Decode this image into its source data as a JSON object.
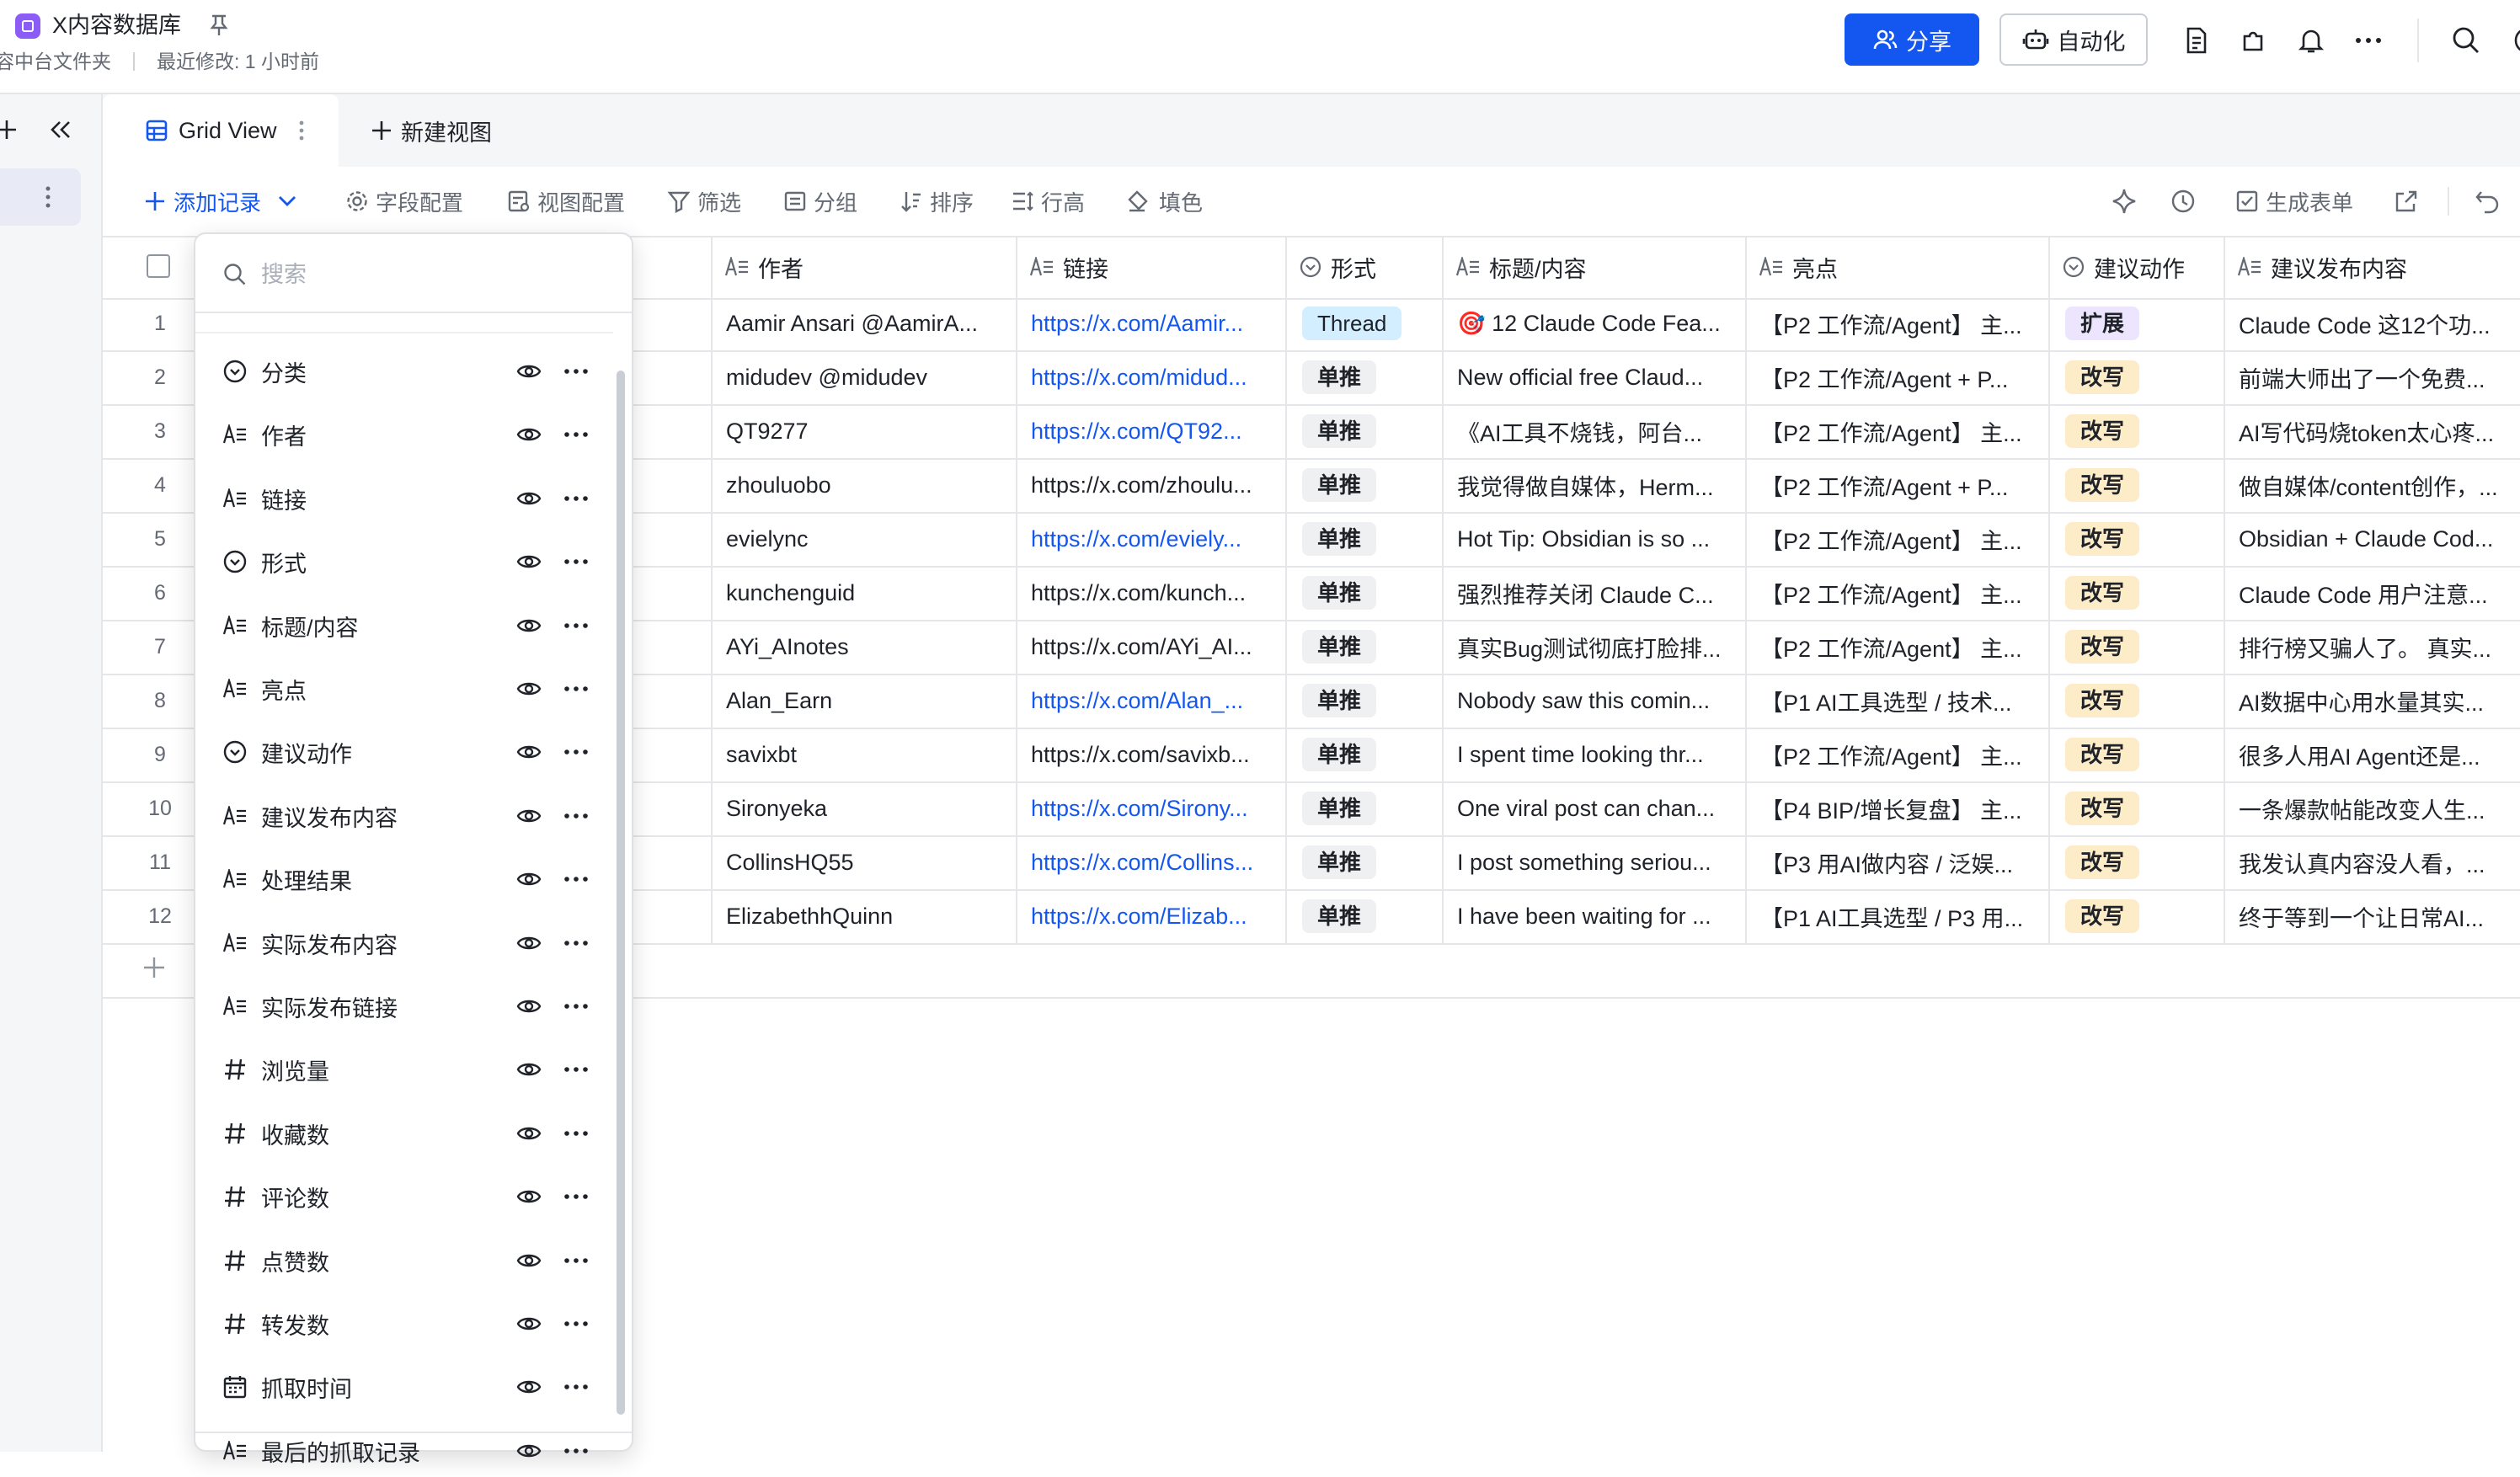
{
  "header": {
    "app_title": "X内容数据库",
    "breadcrumb_folder": "容中台文件夹",
    "last_modified": "最近修改: 1 小时前",
    "share_label": "分享",
    "automation_label": "自动化"
  },
  "tabs": {
    "grid_view": "Grid View",
    "new_view": "新建视图"
  },
  "toolbar": {
    "add_record": "添加记录",
    "field_config": "字段配置",
    "view_config": "视图配置",
    "filter": "筛选",
    "group": "分组",
    "sort": "排序",
    "row_height": "行高",
    "fill_color": "填色",
    "generate_form": "生成表单"
  },
  "columns": {
    "author": "作者",
    "link": "链接",
    "format": "形式",
    "title": "标题/内容",
    "highlight": "亮点",
    "action": "建议动作",
    "suggested_content": "建议发布内容"
  },
  "rows": [
    {
      "num": "1",
      "author": "Aamir Ansari @AamirA...",
      "link": "https://x.com/Aamir...",
      "link_blue": true,
      "format": "Thread",
      "title": "🎯 12 Claude Code Fea...",
      "highlight": "【P2 工作流/Agent】 主...",
      "action": "扩展",
      "content": "Claude Code 这12个功..."
    },
    {
      "num": "2",
      "author": "midudev @midudev",
      "link": "https://x.com/midud...",
      "link_blue": true,
      "format": "单推",
      "title": "New official free Claud...",
      "highlight": "【P2 工作流/Agent + P...",
      "action": "改写",
      "content": "前端大师出了一个免费..."
    },
    {
      "num": "3",
      "author": "QT9277",
      "link": "https://x.com/QT92...",
      "link_blue": true,
      "format": "单推",
      "title": "《AI工具不烧钱，阿台...",
      "highlight": "【P2 工作流/Agent】 主...",
      "action": "改写",
      "content": "AI写代码烧token太心疼..."
    },
    {
      "num": "4",
      "author": "zhouluobo",
      "link": "https://x.com/zhoulu...",
      "link_blue": false,
      "format": "单推",
      "title": "我觉得做自媒体，Herm...",
      "highlight": "【P2 工作流/Agent + P...",
      "action": "改写",
      "content": "做自媒体/content创作，..."
    },
    {
      "num": "5",
      "author": "evielync",
      "link": "https://x.com/eviely...",
      "link_blue": true,
      "format": "单推",
      "title": "Hot Tip: Obsidian is so ...",
      "highlight": "【P2 工作流/Agent】 主...",
      "action": "改写",
      "content": "Obsidian + Claude Cod..."
    },
    {
      "num": "6",
      "author": "kunchenguid",
      "link": "https://x.com/kunch...",
      "link_blue": false,
      "format": "单推",
      "title": "强烈推荐关闭 Claude C...",
      "highlight": "【P2 工作流/Agent】 主...",
      "action": "改写",
      "content": "Claude Code 用户注意..."
    },
    {
      "num": "7",
      "author": "AYi_AInotes",
      "link": "https://x.com/AYi_AI...",
      "link_blue": false,
      "format": "单推",
      "title": "真实Bug测试彻底打脸排...",
      "highlight": "【P2 工作流/Agent】 主...",
      "action": "改写",
      "content": "排行榜又骗人了。 真实..."
    },
    {
      "num": "8",
      "author": "Alan_Earn",
      "link": "https://x.com/Alan_...",
      "link_blue": true,
      "format": "单推",
      "title": "Nobody saw this comin...",
      "highlight": "【P1 AI工具选型 / 技术...",
      "action": "改写",
      "content": "AI数据中心用水量其实..."
    },
    {
      "num": "9",
      "author": "savixbt",
      "link": "https://x.com/savixb...",
      "link_blue": false,
      "format": "单推",
      "title": "I spent time looking thr...",
      "highlight": "【P2 工作流/Agent】 主...",
      "action": "改写",
      "content": "很多人用AI Agent还是..."
    },
    {
      "num": "10",
      "author": "Sironyeka",
      "link": "https://x.com/Sirony...",
      "link_blue": true,
      "format": "单推",
      "title": "One viral post can chan...",
      "highlight": "【P4 BIP/增长复盘】 主...",
      "action": "改写",
      "content": "一条爆款帖能改变人生..."
    },
    {
      "num": "11",
      "author": "CollinsHQ55",
      "link": "https://x.com/Collins...",
      "link_blue": true,
      "format": "单推",
      "title": "I post something seriou...",
      "highlight": "【P3 用AI做内容 / 泛娱...",
      "action": "改写",
      "content": "我发认真内容没人看，..."
    },
    {
      "num": "12",
      "author": "ElizabethhQuinn",
      "link": "https://x.com/Elizab...",
      "link_blue": true,
      "format": "单推",
      "title": "I have been waiting for ...",
      "highlight": "【P1 AI工具选型 / P3 用...",
      "action": "改写",
      "content": "终于等到一个让日常AI..."
    }
  ],
  "field_popover": {
    "search_placeholder": "搜索",
    "fields": [
      {
        "label": "分类",
        "icon": "single-select-icon"
      },
      {
        "label": "作者",
        "icon": "text-field-icon"
      },
      {
        "label": "链接",
        "icon": "text-field-icon"
      },
      {
        "label": "形式",
        "icon": "single-select-icon"
      },
      {
        "label": "标题/内容",
        "icon": "text-field-icon"
      },
      {
        "label": "亮点",
        "icon": "text-field-icon"
      },
      {
        "label": "建议动作",
        "icon": "single-select-icon"
      },
      {
        "label": "建议发布内容",
        "icon": "text-field-icon"
      },
      {
        "label": "处理结果",
        "icon": "text-field-icon"
      },
      {
        "label": "实际发布内容",
        "icon": "text-field-icon"
      },
      {
        "label": "实际发布链接",
        "icon": "text-field-icon"
      },
      {
        "label": "浏览量",
        "icon": "number-field-icon"
      },
      {
        "label": "收藏数",
        "icon": "number-field-icon"
      },
      {
        "label": "评论数",
        "icon": "number-field-icon"
      },
      {
        "label": "点赞数",
        "icon": "number-field-icon"
      },
      {
        "label": "转发数",
        "icon": "number-field-icon"
      },
      {
        "label": "抓取时间",
        "icon": "date-field-icon"
      },
      {
        "label": "最后的抓取记录",
        "icon": "text-field-icon"
      }
    ]
  },
  "colors": {
    "accent": "#1456f0",
    "thread_tag": "#d3efff",
    "single_tag": "#eff0f1",
    "rewrite_tag": "#fdecc8",
    "expand_tag": "#ece5fd"
  }
}
